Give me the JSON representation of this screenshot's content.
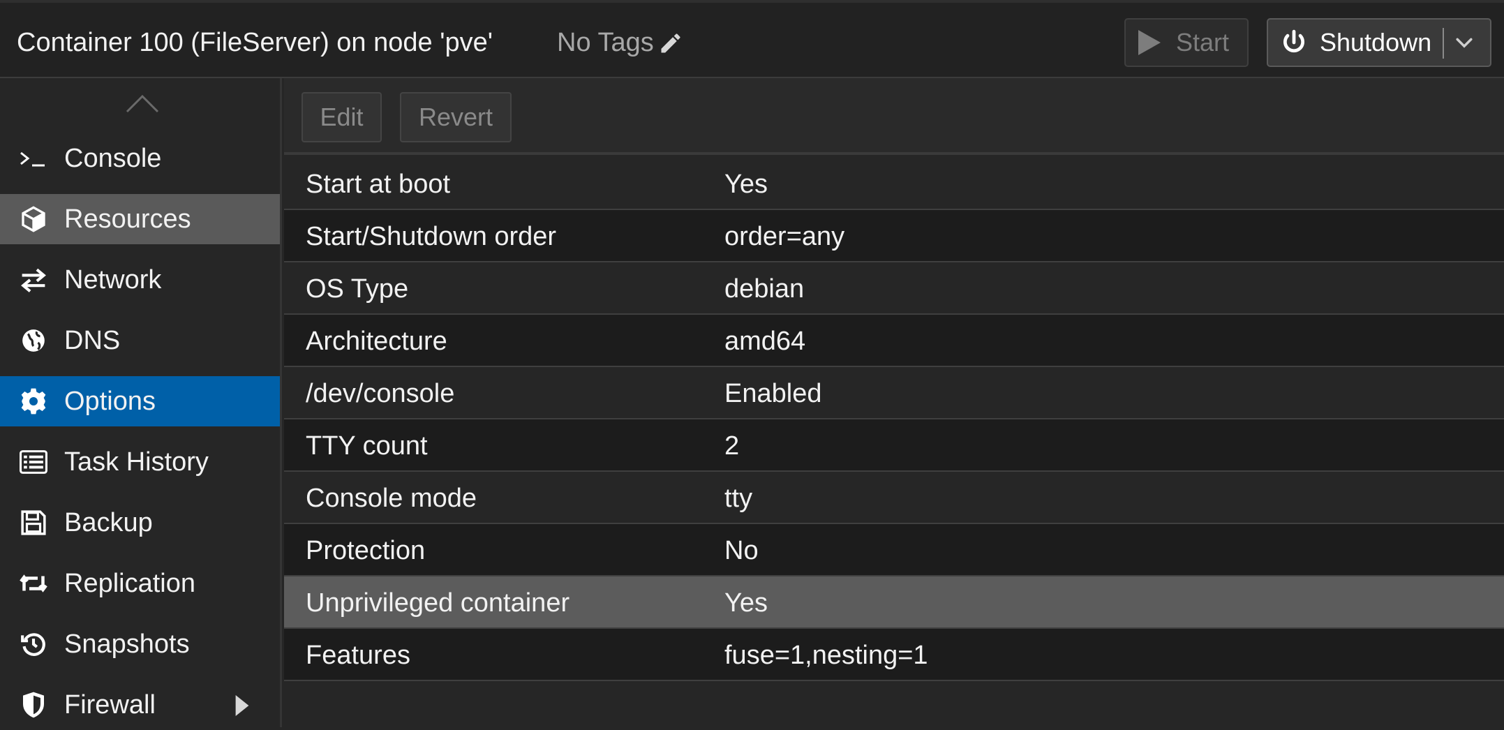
{
  "header": {
    "title": "Container 100 (FileServer) on node 'pve'",
    "tags": "No Tags",
    "start_label": "Start",
    "shutdown_label": "Shutdown"
  },
  "sidebar": {
    "items": [
      {
        "label": "Console",
        "icon": "console-icon"
      },
      {
        "label": "Resources",
        "icon": "cube-icon"
      },
      {
        "label": "Network",
        "icon": "exchange-icon"
      },
      {
        "label": "DNS",
        "icon": "globe-icon"
      },
      {
        "label": "Options",
        "icon": "gear-icon"
      },
      {
        "label": "Task History",
        "icon": "list-icon"
      },
      {
        "label": "Backup",
        "icon": "floppy-icon"
      },
      {
        "label": "Replication",
        "icon": "retweet-icon"
      },
      {
        "label": "Snapshots",
        "icon": "history-icon"
      },
      {
        "label": "Firewall",
        "icon": "shield-icon"
      }
    ],
    "hovered": "Resources",
    "active": "Options"
  },
  "toolbar": {
    "edit_label": "Edit",
    "revert_label": "Revert"
  },
  "options": {
    "rows": [
      {
        "key": "Start at boot",
        "value": "Yes"
      },
      {
        "key": "Start/Shutdown order",
        "value": "order=any"
      },
      {
        "key": "OS Type",
        "value": "debian"
      },
      {
        "key": "Architecture",
        "value": "amd64"
      },
      {
        "key": "/dev/console",
        "value": "Enabled"
      },
      {
        "key": "TTY count",
        "value": "2"
      },
      {
        "key": "Console mode",
        "value": "tty"
      },
      {
        "key": "Protection",
        "value": "No"
      },
      {
        "key": "Unprivileged container",
        "value": "Yes"
      },
      {
        "key": "Features",
        "value": "fuse=1,nesting=1"
      }
    ],
    "selected": "Unprivileged container"
  },
  "colors": {
    "active_nav": "#0060a8",
    "hover_nav": "#5a5a5a",
    "selected_row": "#5c5c5c",
    "background": "#262626"
  }
}
